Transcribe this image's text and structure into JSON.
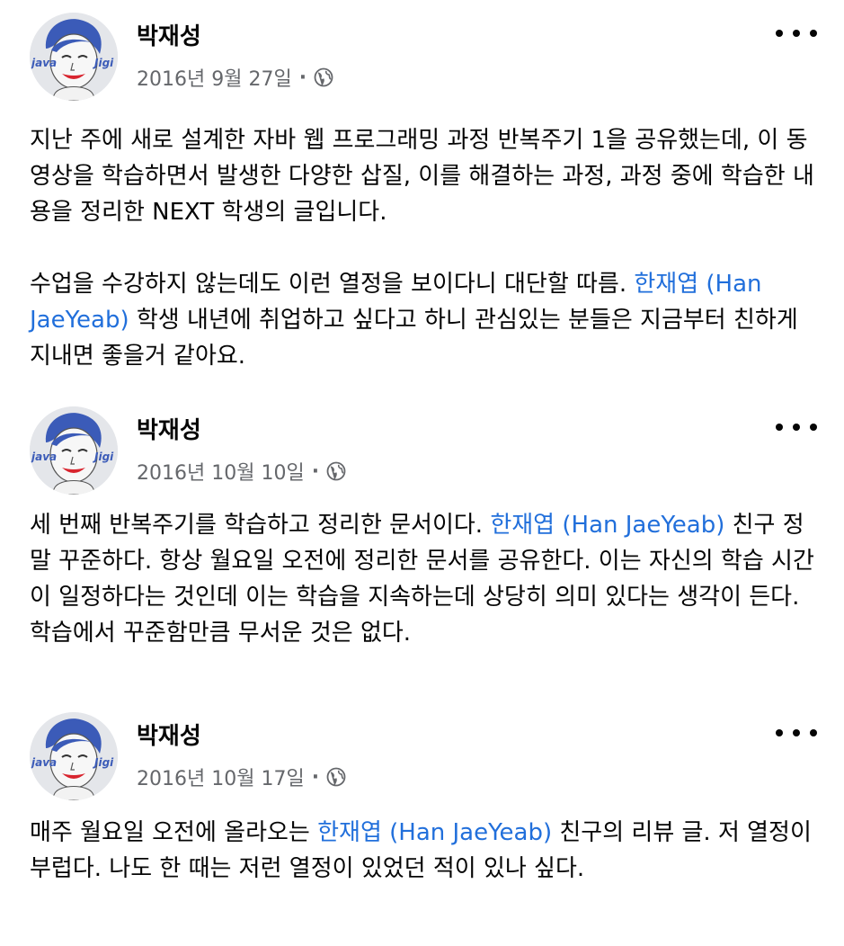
{
  "posts": [
    {
      "author": "박재성",
      "date": "2016년 9월 27일",
      "separator": "·",
      "privacy_icon": "globe-icon",
      "paragraphs": [
        [
          {
            "text": "지난 주에 새로 설계한 자바 웹 프로그래밍 과정 반복주기 1을 공유했는데, 이 동영상을 학습하면서 발생한 다양한 삽질, 이를 해결하는 과정, 과정 중에 학습한 내용을 정리한 NEXT 학생의 글입니다."
          }
        ],
        [
          {
            "text": "수업을 수강하지 않는데도 이런 열정을 보이다니 대단할 따름. "
          },
          {
            "text": "한재엽 (Han JaeYeab)",
            "mention": true
          },
          {
            "text": " 학생 내년에 취업하고 싶다고 하니 관심있는 분들은 지금부터 친하게 지내면 좋을거 같아요."
          }
        ]
      ]
    },
    {
      "author": "박재성",
      "date": "2016년 10월 10일",
      "separator": "·",
      "privacy_icon": "globe-icon",
      "paragraphs": [
        [
          {
            "text": "세 번째 반복주기를 학습하고 정리한 문서이다. "
          },
          {
            "text": "한재엽 (Han JaeYeab)",
            "mention": true
          },
          {
            "text": " 친구 정말 꾸준하다. 항상 월요일 오전에 정리한 문서를 공유한다. 이는 자신의 학습 시간이 일정하다는 것인데 이는 학습을 지속하는데 상당히 의미 있다는 생각이 든다. 학습에서 꾸준함만큼 무서운 것은 없다."
          }
        ]
      ]
    },
    {
      "author": "박재성",
      "date": "2016년 10월 17일",
      "separator": "·",
      "privacy_icon": "globe-icon",
      "paragraphs": [
        [
          {
            "text": "매주 월요일 오전에 올라오는 "
          },
          {
            "text": "한재엽 (Han JaeYeab)",
            "mention": true
          },
          {
            "text": " 친구의 리뷰 글. 저 열정이 부럽다. 나도 한 때는 저런 열정이 있었던 적이 있나 싶다."
          }
        ]
      ]
    }
  ],
  "colors": {
    "mention": "#216fdb",
    "meta": "#65676b",
    "text": "#050505"
  }
}
